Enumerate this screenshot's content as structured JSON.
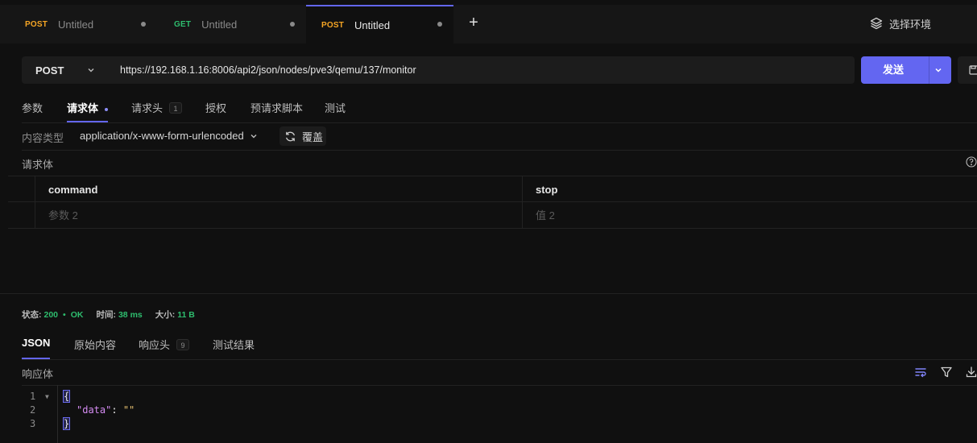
{
  "tabs": [
    {
      "method": "POST",
      "title": "Untitled"
    },
    {
      "method": "GET",
      "title": "Untitled"
    },
    {
      "method": "POST",
      "title": "Untitled"
    }
  ],
  "new_tab_label": "+",
  "environment": {
    "label": "选择环境"
  },
  "request": {
    "method": "POST",
    "url": "https://192.168.1.16:8006/api2/json/nodes/pve3/qemu/137/monitor",
    "send_label": "发送"
  },
  "request_tabs": {
    "params": "参数",
    "body": "请求体",
    "headers": "请求头",
    "headers_count": "1",
    "auth": "授权",
    "pre_script": "预请求脚本",
    "tests": "测试"
  },
  "body": {
    "content_type_label": "内容类型",
    "content_type": "application/x-www-form-urlencoded",
    "override_label": "覆盖",
    "section_label": "请求体",
    "rows": [
      {
        "key": "command",
        "value": "stop"
      }
    ],
    "placeholder_key": "参数 2",
    "placeholder_value": "值 2"
  },
  "status": {
    "status_label": "状态:",
    "code": "200",
    "sep": "•",
    "text": "OK",
    "time_label": "时间:",
    "time": "38 ms",
    "size_label": "大小:",
    "size": "11 B"
  },
  "response_tabs": {
    "json": "JSON",
    "raw": "原始内容",
    "headers": "响应头",
    "headers_count": "9",
    "test_results": "测试结果"
  },
  "response": {
    "section_label": "响应体",
    "line_numbers": [
      "1",
      "2",
      "3"
    ],
    "open_brace": "{",
    "key": "\"data\"",
    "colon": ": ",
    "value": "\"\"",
    "close_brace": "}"
  },
  "colors": {
    "accent": "#6366f1",
    "post": "#f5a524",
    "get": "#2ebd6e",
    "ok": "#2ebd6e"
  }
}
